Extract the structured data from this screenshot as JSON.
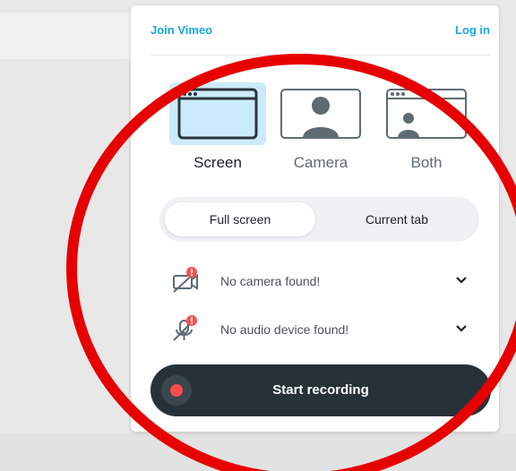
{
  "header": {
    "join_label": "Join Vimeo",
    "login_label": "Log in"
  },
  "modes": [
    {
      "label": "Screen",
      "icon": "browser-window-icon",
      "selected": true
    },
    {
      "label": "Camera",
      "icon": "user-icon",
      "selected": false
    },
    {
      "label": "Both",
      "icon": "window-with-user-icon",
      "selected": false
    }
  ],
  "capture_toggle": {
    "options": [
      "Full screen",
      "Current tab"
    ],
    "selected": "Full screen"
  },
  "devices": {
    "camera": {
      "label": "No camera found!",
      "icon": "camera-off-icon",
      "status": "error"
    },
    "audio": {
      "label": "No audio device found!",
      "icon": "mic-off-icon",
      "status": "error"
    }
  },
  "record": {
    "label": "Start recording"
  },
  "colors": {
    "accent": "#17a6e0",
    "selected_tile": "#ccebfa",
    "record_button": "#273238",
    "record_dot": "#ff4d4d",
    "error_badge": "#ff4d4d",
    "annotation_circle": "#e60000"
  }
}
